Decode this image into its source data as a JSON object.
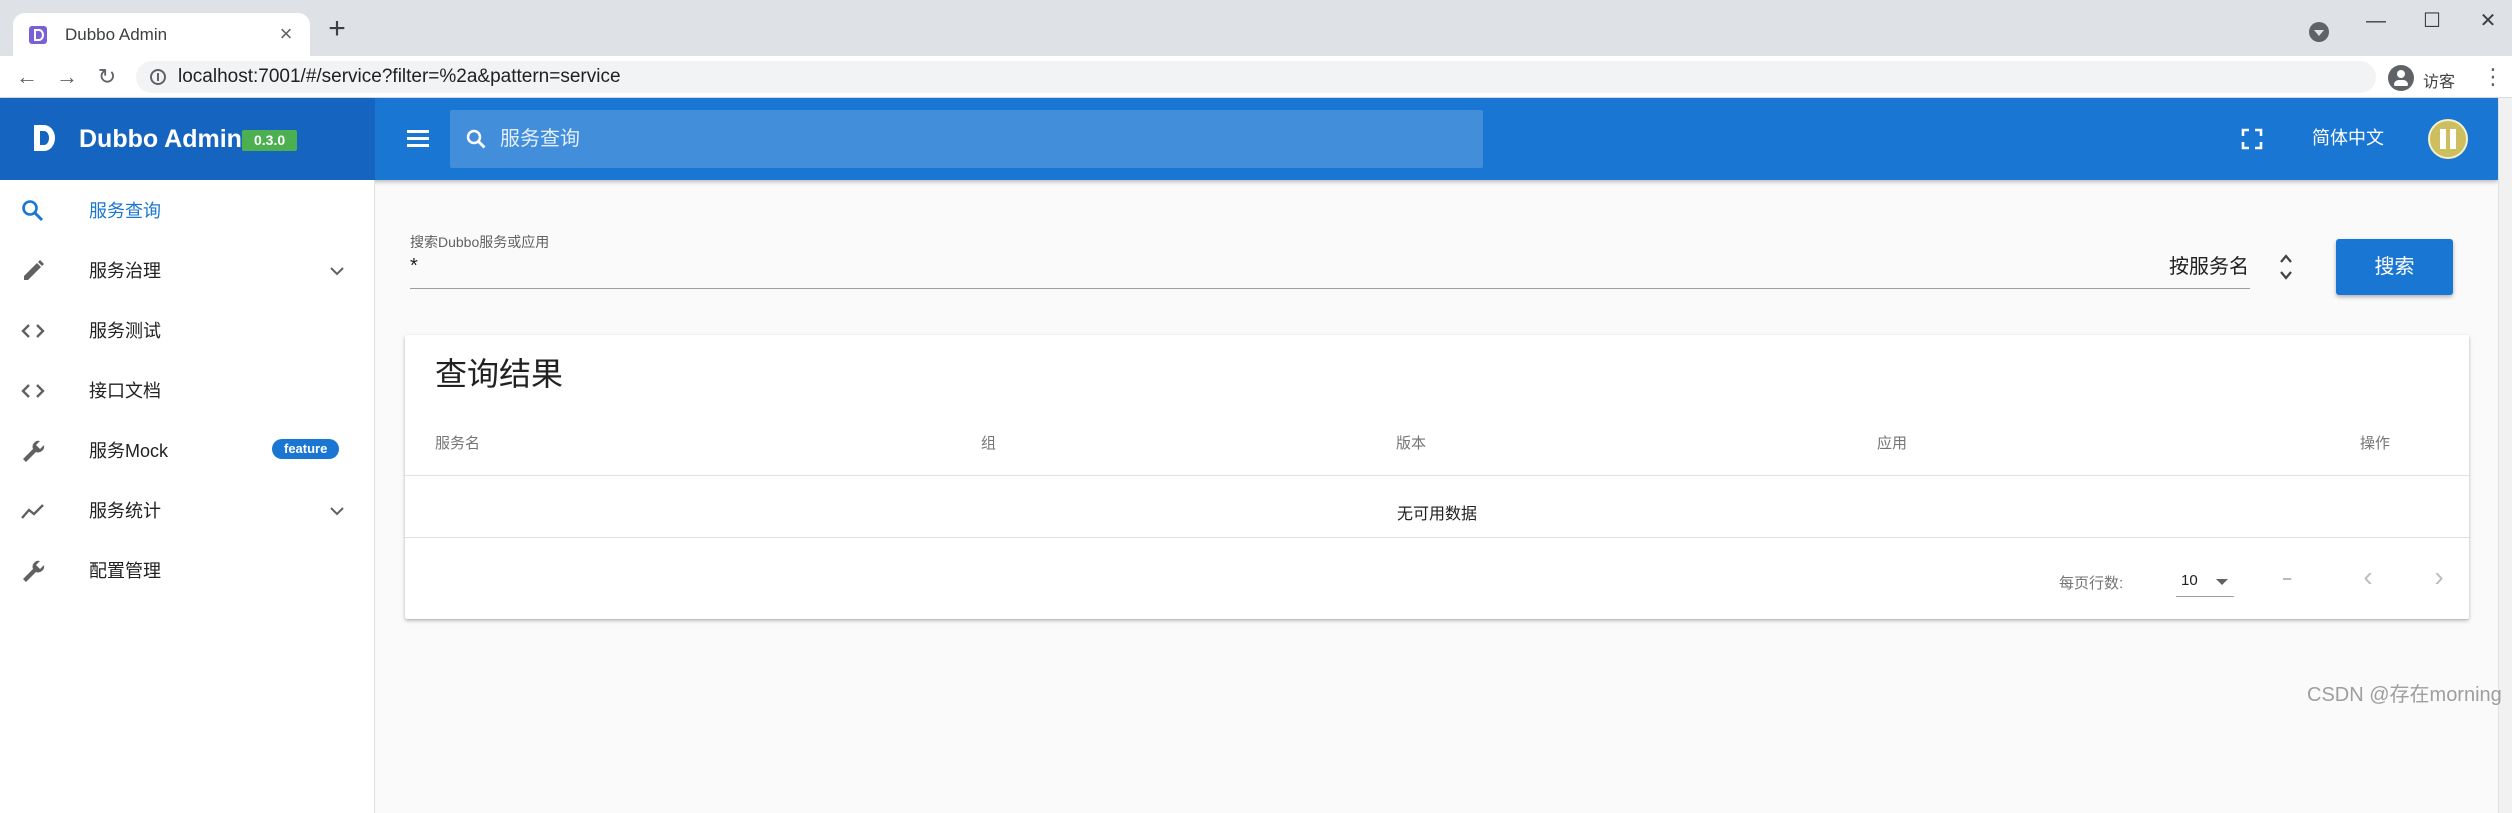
{
  "browser": {
    "tab_title": "Dubbo Admin",
    "tab_close": "×",
    "new_tab": "+",
    "url": "localhost:7001/#/service?filter=%2a&pattern=service",
    "back": "←",
    "forward": "→",
    "reload": "↻",
    "profile_label": "访客",
    "menu": "⋮",
    "minimize": "—",
    "maximize": "☐",
    "close": "✕"
  },
  "app": {
    "brand_title": "Dubbo Admin",
    "version": "0.3.0",
    "search_placeholder": "服务查询",
    "language": "简体中文",
    "accent_color": "#1976d2"
  },
  "sidebar": {
    "items": [
      {
        "label": "服务查询",
        "icon": "search-icon",
        "active": true
      },
      {
        "label": "服务治理",
        "icon": "pencil-icon",
        "expandable": true
      },
      {
        "label": "服务测试",
        "icon": "code-icon"
      },
      {
        "label": "接口文档",
        "icon": "code-icon"
      },
      {
        "label": "服务Mock",
        "icon": "wrench-icon",
        "badge": "feature"
      },
      {
        "label": "服务统计",
        "icon": "trending-icon",
        "expandable": true
      },
      {
        "label": "配置管理",
        "icon": "wrench-icon"
      }
    ]
  },
  "search": {
    "label": "搜索Dubbo服务或应用",
    "value": "*",
    "pattern": "按服务名",
    "button": "搜索"
  },
  "results": {
    "title": "查询结果",
    "columns": [
      "服务名",
      "组",
      "版本",
      "应用",
      "操作"
    ],
    "empty": "无可用数据",
    "rows_per_page_label": "每页行数:",
    "rows_per_page": "10",
    "range": "–",
    "prev": "‹",
    "next": "›"
  },
  "watermark": "CSDN @存在morning"
}
